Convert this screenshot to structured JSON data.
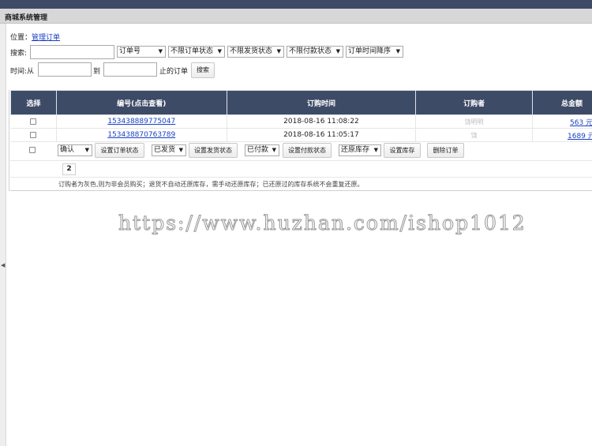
{
  "header": {
    "title": "商城系统管理"
  },
  "breadcrumb": {
    "prefix": "位置：",
    "link": "管理订单"
  },
  "search": {
    "label": "搜索:",
    "value": "",
    "field_select": "订单号",
    "order_status_select": "不限订单状态",
    "ship_status_select": "不限发货状态",
    "pay_status_select": "不限付款状态",
    "sort_select": "订单时间降序"
  },
  "time_filter": {
    "from_label": "时间:从",
    "to_label": "到",
    "until_label": "止的订单",
    "search_button": "搜索"
  },
  "table": {
    "headers": [
      "选择",
      "编号(点击查看)",
      "订购时间",
      "订购者",
      "总金额"
    ],
    "rows": [
      {
        "order_no": "153438889775047",
        "time": "2018-08-16 11:08:22",
        "buyer": "饶明明",
        "amount": "563 元"
      },
      {
        "order_no": "153438870763789",
        "time": "2018-08-16 11:05:17",
        "buyer": "饶",
        "amount": "1689 元"
      }
    ]
  },
  "actions": {
    "order_status_select": "确认",
    "set_order_status": "设置订单状态",
    "ship_select": "已发货",
    "set_ship_status": "设置发货状态",
    "pay_select": "已付款",
    "set_pay_status": "设置付款状态",
    "stock_select": "还原库存",
    "set_stock": "设置库存",
    "delete_order": "删除订单"
  },
  "pager": {
    "page": "2"
  },
  "note": "订购者为灰色,则为非会员购买；退货不自动还原库存，需手动还原库存；已还原过的库存系统不会重复还原。",
  "watermark": "https://www.huzhan.com/ishop1012"
}
